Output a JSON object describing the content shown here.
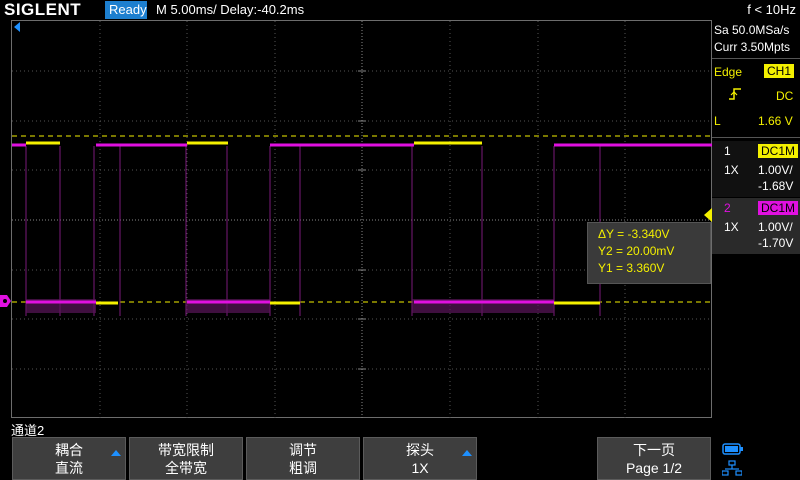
{
  "header": {
    "brand": "SIGLENT",
    "status": "Ready",
    "timebase": "M 5.00ms/ Delay:-40.2ms",
    "frequency": "f < 10Hz"
  },
  "acquisition": {
    "sample_rate": "Sa 50.0MSa/s",
    "memory": "Curr 3.50Mpts"
  },
  "trigger": {
    "type_label": "Edge",
    "source": "CH1",
    "coupling": "DC",
    "level_label": "L",
    "level": "1.66 V"
  },
  "channels": [
    {
      "number": "1",
      "coupling": "DC1M",
      "probe": "1X",
      "scale": "1.00V/",
      "offset": "-1.68V",
      "color": "#f4f000"
    },
    {
      "number": "2",
      "coupling": "DC1M",
      "probe": "1X",
      "scale": "1.00V/",
      "offset": "-1.70V",
      "color": "#e010e0"
    }
  ],
  "cursors": {
    "delta": "ΔY = -3.340V",
    "y2": "Y2 = 20.00mV",
    "y1": "Y1 = 3.360V"
  },
  "menu": {
    "title": "通道2",
    "keys": [
      {
        "line1": "耦合",
        "line2": "直流"
      },
      {
        "line1": "带宽限制",
        "line2": "全带宽"
      },
      {
        "line1": "调节",
        "line2": "粗调"
      },
      {
        "line1": "探头",
        "line2": "1X"
      },
      {
        "line1": "下一页",
        "line2": "Page 1/2"
      }
    ]
  },
  "colors": {
    "ch1": "#f4f000",
    "ch2": "#e010e0",
    "accent": "#1d7fcf"
  }
}
